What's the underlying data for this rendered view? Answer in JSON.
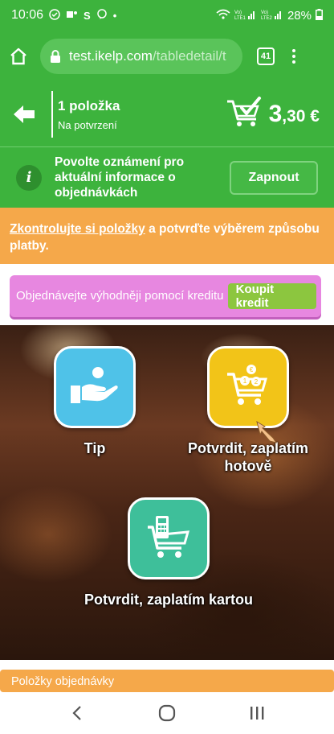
{
  "status_bar": {
    "time": "10:06",
    "left_icons": [
      "check-circle-icon",
      "teams-icon",
      "skype-icon",
      "chat-icon",
      "dot-icon"
    ],
    "right_icons": [
      "wifi-icon",
      "signal-lte1-icon",
      "signal-lte2-icon"
    ],
    "battery": "28%"
  },
  "browser": {
    "url_domain": "test.ikelp.com",
    "url_path": "/tabledetail/t",
    "tab_count": "41"
  },
  "order": {
    "item_count": "1 položka",
    "status": "Na potvrzení",
    "price_int": "3",
    "price_dec": ",30 €"
  },
  "notification": {
    "text": "Povolte oznámení pro aktuální informace o objednávkách",
    "button": "Zapnout"
  },
  "info": {
    "link": "Zkontrolujte si položky",
    "text": " a potvrďte výběrem způsobu platby."
  },
  "credit": {
    "text": "Objednávejte výhodněji pomocí kreditu",
    "button": "Koupit kredit"
  },
  "tiles": {
    "tip": "Tip",
    "cash": "Potvrdit, zaplatím hotově",
    "card": "Potvrdit, zaplatím kartou"
  },
  "items_bar": {
    "label": "Položky objednávky"
  },
  "colors": {
    "primary_green": "#3db33d",
    "orange": "#f5a84a",
    "pink": "#e787e0",
    "lime": "#8cc63f",
    "tip_blue": "#4fc2e8",
    "cash_yellow": "#f2c418",
    "card_teal": "#3ebf9a"
  }
}
